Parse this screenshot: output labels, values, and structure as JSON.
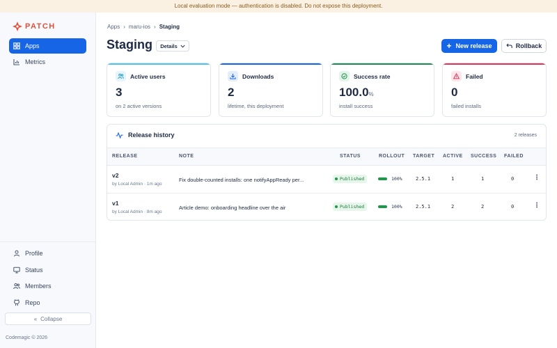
{
  "banner": "Local evaluation mode — authentication is disabled. Do not expose this deployment.",
  "brand": {
    "name": "PATCH",
    "color": "#e2513a"
  },
  "accent": "#1665e6",
  "sidebar": {
    "main_items": [
      {
        "label": "Apps",
        "icon": "grid-icon",
        "active": true
      },
      {
        "label": "Metrics",
        "icon": "bar-chart-icon",
        "active": false
      }
    ],
    "bottom_items": [
      {
        "label": "Profile",
        "icon": "user-icon"
      },
      {
        "label": "Status",
        "icon": "monitor-icon"
      },
      {
        "label": "Members",
        "icon": "users-icon"
      },
      {
        "label": "Repo",
        "icon": "github-icon"
      }
    ],
    "collapse_label": "Collapse",
    "copyright": "Codemagic © 2026"
  },
  "breadcrumb": {
    "items": [
      "Apps",
      "maru-ios"
    ],
    "current": "Staging"
  },
  "page": {
    "title": "Staging",
    "details_label": "Details"
  },
  "actions": {
    "new_release": "New release",
    "rollback": "Rollback"
  },
  "stats": [
    {
      "label": "Active users",
      "value": "3",
      "unit": "",
      "sub": "on 2 active versions",
      "icon": "users-icon",
      "color": "#4ec2e8"
    },
    {
      "label": "Downloads",
      "value": "2",
      "unit": "",
      "sub": "lifetime, this deployment",
      "icon": "download-icon",
      "color": "#1665e6"
    },
    {
      "label": "Success rate",
      "value": "100.0",
      "unit": "%",
      "sub": "install success",
      "icon": "check-circle-icon",
      "color": "#1f8a4c"
    },
    {
      "label": "Failed",
      "value": "0",
      "unit": "",
      "sub": "failed installs",
      "icon": "warning-icon",
      "color": "#e0325a"
    }
  ],
  "history": {
    "title": "Release history",
    "count": "2 releases",
    "columns": [
      "RELEASE",
      "NOTE",
      "STATUS",
      "ROLLOUT",
      "TARGET",
      "ACTIVE",
      "SUCCESS",
      "FAILED"
    ],
    "rows": [
      {
        "release": "v2",
        "by": "by Local Admin · 1m ago",
        "note": "Fix double-counted installs: one notifyAppReady per...",
        "status": "Published",
        "rollout": "100%",
        "rollout_fraction": 1.0,
        "target": "2.5.1",
        "active": "1",
        "success": "1",
        "failed": "0"
      },
      {
        "release": "v1",
        "by": "by Local Admin · 8m ago",
        "note": "Article demo: onboarding headline over the air",
        "status": "Published",
        "rollout": "100%",
        "rollout_fraction": 1.0,
        "target": "2.5.1",
        "active": "2",
        "success": "2",
        "failed": "0"
      }
    ]
  }
}
